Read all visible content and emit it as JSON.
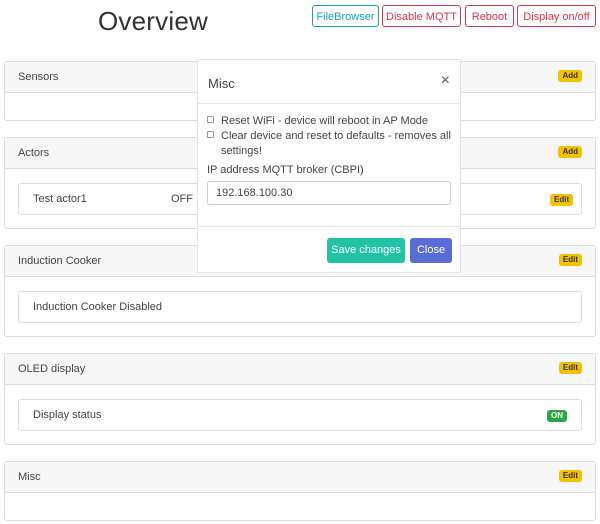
{
  "header": {
    "title": "Overview",
    "buttons": {
      "filebrowser": "FileBrowser",
      "disable_mqtt": "Disable MQTT",
      "reboot": "Reboot",
      "display_toggle": "Display on/off"
    }
  },
  "cards": {
    "sensors": {
      "title": "Sensors",
      "badge": "Add"
    },
    "actors": {
      "title": "Actors",
      "badge": "Add",
      "item": {
        "name": "Test actor1",
        "state": "OFF",
        "badge": "Edit"
      }
    },
    "induction": {
      "title": "Induction Cooker",
      "badge": "Edit",
      "item": {
        "name": "Induction Cooker Disabled"
      }
    },
    "oled": {
      "title": "OLED display",
      "badge": "Edit",
      "item": {
        "name": "Display status",
        "state": "ON"
      }
    },
    "misc": {
      "title": "Misc",
      "badge": "Edit"
    }
  },
  "modal": {
    "title": "Misc",
    "close_symbol": "×",
    "checkboxes": [
      "Reset WiFi - device will reboot in AP Mode",
      "Clear device and reset to defaults - removes all settings!"
    ],
    "ip_label": "IP address MQTT broker (CBPI)",
    "ip_value": "192.168.100.30",
    "save_label": "Save changes",
    "close_label": "Close"
  },
  "colors": {
    "info": "#17a2b8",
    "danger": "#dc3545",
    "warning_badge": "#f2c200",
    "success_badge": "#28a745",
    "save_button": "#20c4a5",
    "close_button": "#5a6cd6"
  }
}
